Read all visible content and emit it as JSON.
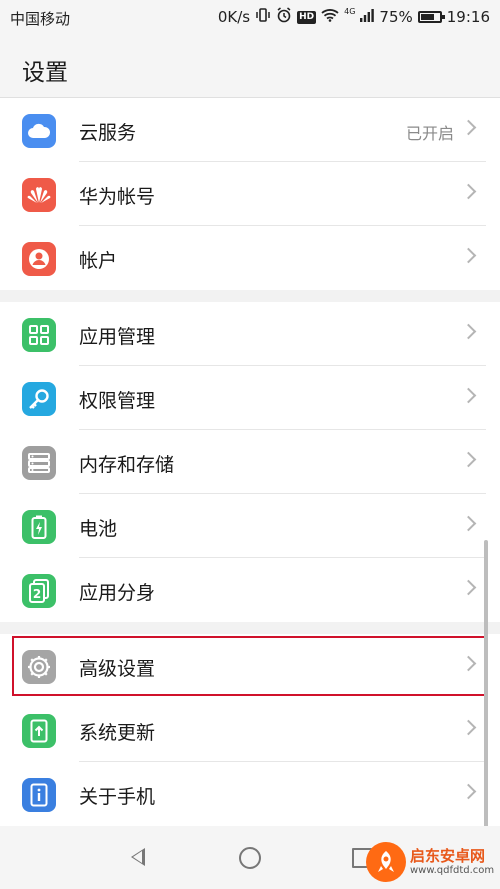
{
  "status_bar": {
    "carrier": "中国移动",
    "speed": "0K/s",
    "network": "4G",
    "battery": "75%",
    "battery_level": 0.75,
    "time": "19:16",
    "hd": "HD"
  },
  "header": {
    "title": "设置"
  },
  "groups": [
    [
      {
        "label": "云服务",
        "value": "已开启",
        "icon": "cloud-icon",
        "color": "#4a8ef0"
      },
      {
        "label": "华为帐号",
        "value": "",
        "icon": "huawei-logo-icon",
        "color": "#ef5a48"
      },
      {
        "label": "帐户",
        "value": "",
        "icon": "user-icon",
        "color": "#ef5a48"
      }
    ],
    [
      {
        "label": "应用管理",
        "value": "",
        "icon": "apps-grid-icon",
        "color": "#3cc068"
      },
      {
        "label": "权限管理",
        "value": "",
        "icon": "key-icon",
        "color": "#25a8e0"
      },
      {
        "label": "内存和存储",
        "value": "",
        "icon": "storage-icon",
        "color": "#9e9e9e"
      },
      {
        "label": "电池",
        "value": "",
        "icon": "battery-icon",
        "color": "#3cc068"
      },
      {
        "label": "应用分身",
        "value": "",
        "icon": "app-twin-icon",
        "color": "#3cc068"
      }
    ],
    [
      {
        "label": "高级设置",
        "value": "",
        "icon": "gear-icon",
        "color": "#a5a5a5"
      },
      {
        "label": "系统更新",
        "value": "",
        "icon": "system-update-icon",
        "color": "#3cc068"
      },
      {
        "label": "关于手机",
        "value": "",
        "icon": "phone-info-icon",
        "color": "#3a7fe0"
      }
    ]
  ],
  "watermark": {
    "title": "启东安卓网",
    "url": "www.qdfdtd.com"
  }
}
